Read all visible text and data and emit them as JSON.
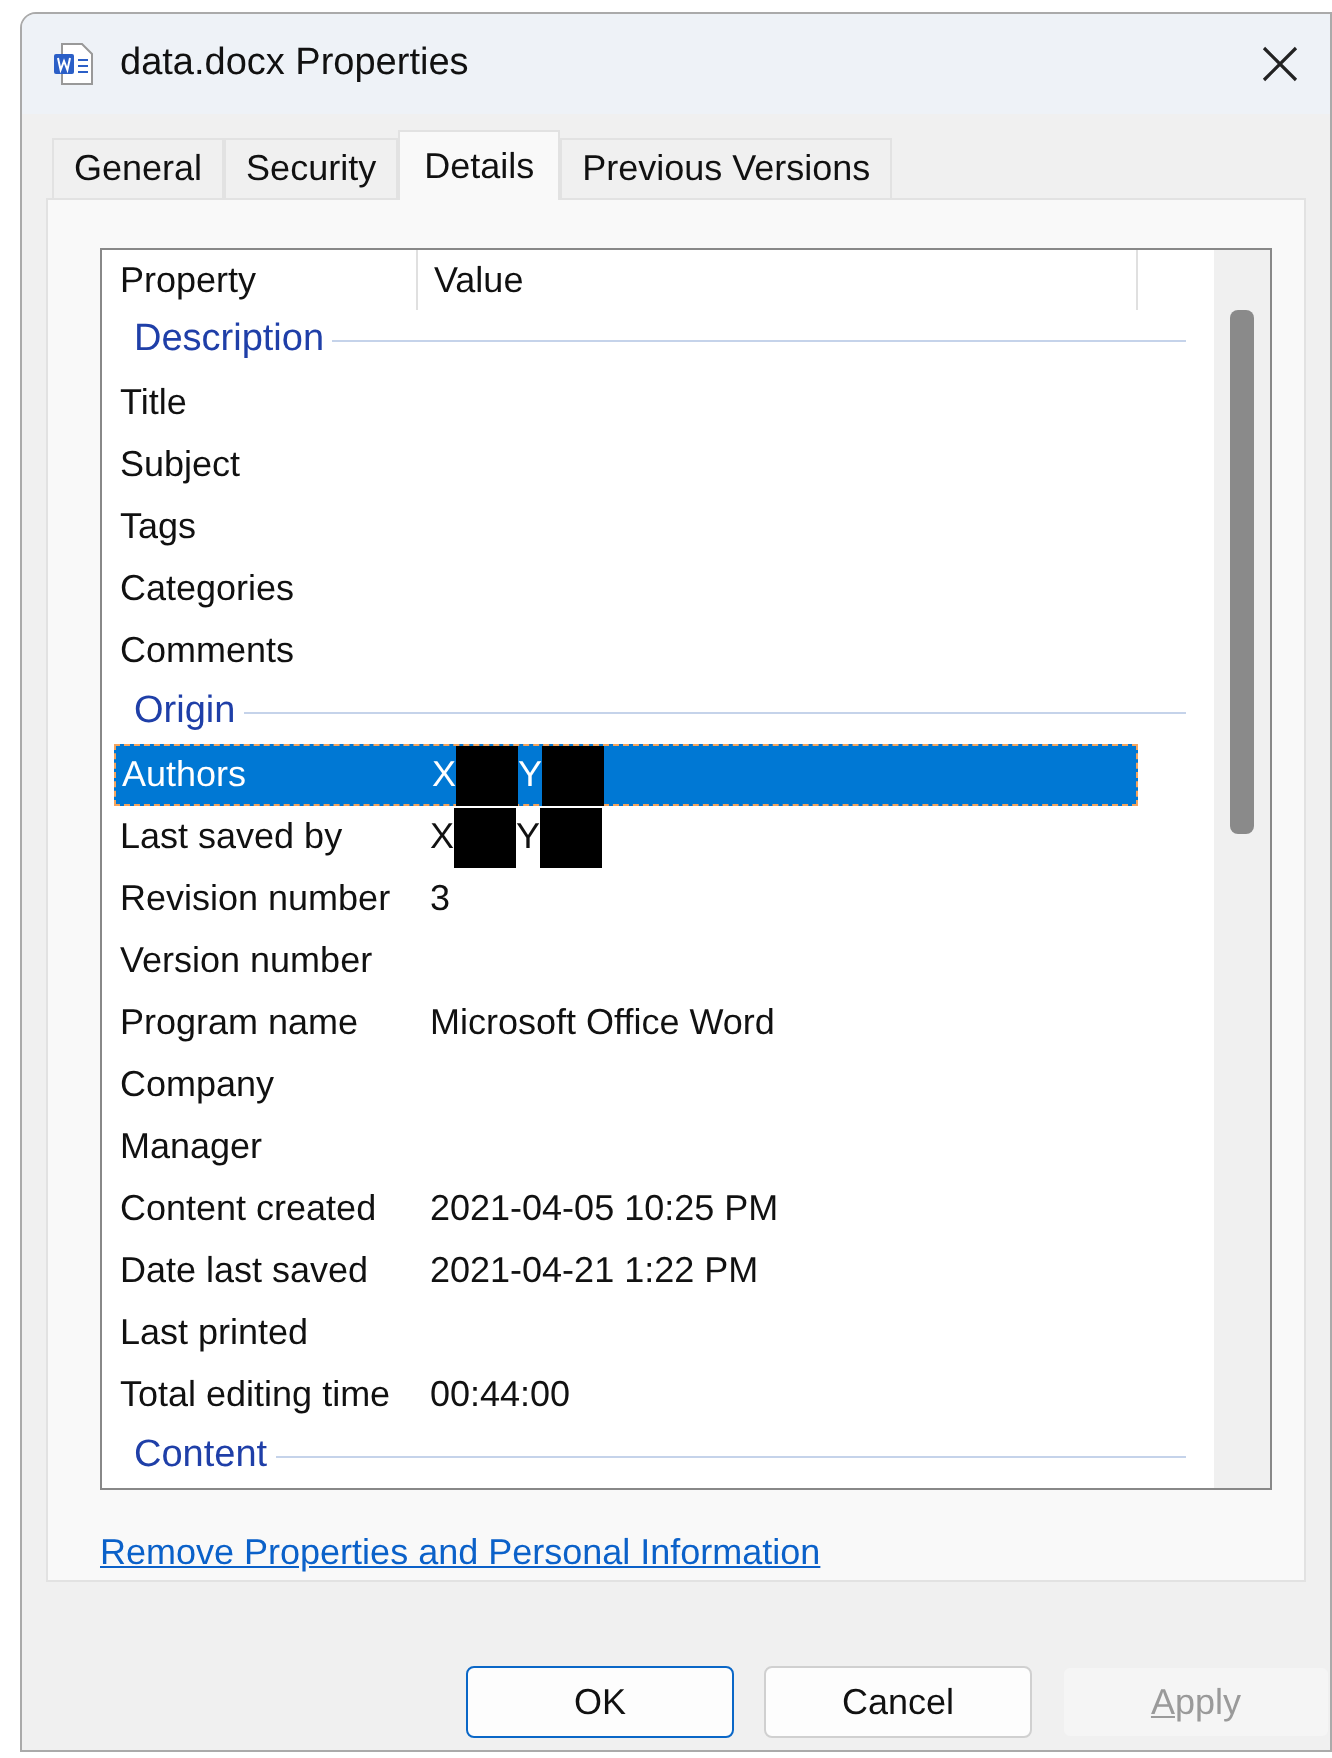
{
  "window": {
    "title": "data.docx Properties"
  },
  "tabs": [
    {
      "label": "General",
      "selected": false
    },
    {
      "label": "Security",
      "selected": false
    },
    {
      "label": "Details",
      "selected": true
    },
    {
      "label": "Previous Versions",
      "selected": false
    }
  ],
  "table": {
    "columns": [
      "Property",
      "Value"
    ],
    "groups": [
      {
        "title": "Description",
        "rows": [
          {
            "property": "Title",
            "selected": false
          },
          {
            "property": "Subject",
            "selected": false
          },
          {
            "property": "Tags",
            "selected": false
          },
          {
            "property": "Categories",
            "selected": false
          },
          {
            "property": "Comments",
            "selected": false
          }
        ]
      },
      {
        "title": "Origin",
        "rows": [
          {
            "property": "Authors",
            "selected": true,
            "value_parts": [
              {
                "text": "X",
                "redacted": true
              },
              {
                "text": "Y",
                "redacted": true
              }
            ]
          },
          {
            "property": "Last saved by",
            "selected": false,
            "value_parts": [
              {
                "text": "X",
                "redacted": true
              },
              {
                "text": "Y",
                "redacted": true
              }
            ]
          },
          {
            "property": "Revision number",
            "selected": false,
            "value": "3"
          },
          {
            "property": "Version number",
            "selected": false
          },
          {
            "property": "Program name",
            "selected": false,
            "value": "Microsoft Office Word"
          },
          {
            "property": "Company",
            "selected": false
          },
          {
            "property": "Manager",
            "selected": false
          },
          {
            "property": "Content created",
            "selected": false,
            "value": "2021-04-05 10:25 PM"
          },
          {
            "property": "Date last saved",
            "selected": false,
            "value": "2021-04-21 1:22 PM"
          },
          {
            "property": "Last printed",
            "selected": false
          },
          {
            "property": "Total editing time",
            "selected": false,
            "value": "00:44:00"
          }
        ]
      },
      {
        "title": "Content"
      }
    ]
  },
  "link": "Remove Properties and Personal Information",
  "buttons": [
    {
      "label": "OK",
      "default": true,
      "disabled": false
    },
    {
      "label": "Cancel",
      "default": false,
      "disabled": false
    },
    {
      "label_parts": [
        {
          "text": "A",
          "underlined": true
        },
        {
          "text": "pply",
          "underlined": false
        }
      ],
      "default": false,
      "disabled": true
    }
  ]
}
